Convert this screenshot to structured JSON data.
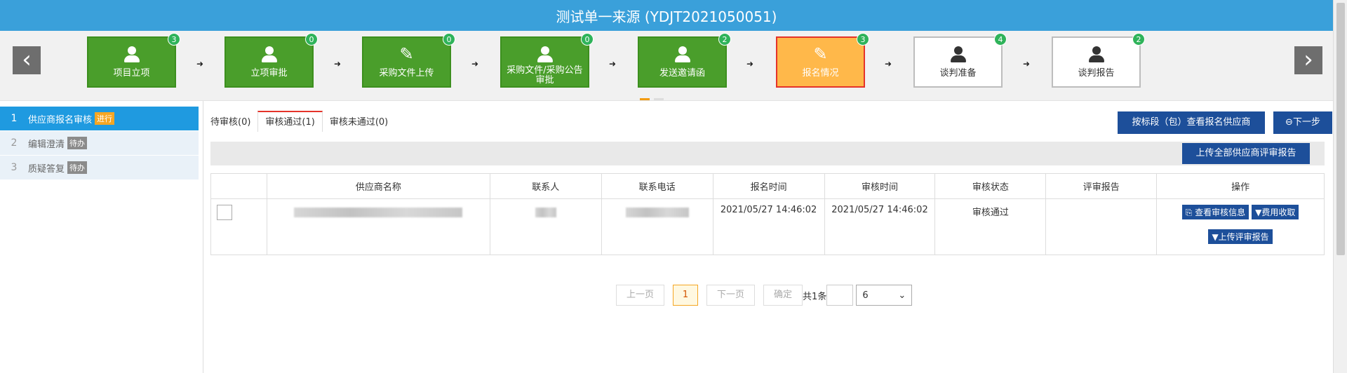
{
  "title": "测试单一来源 (YDJT2021050051)",
  "steps": [
    {
      "label": "项目立项",
      "count": "3",
      "icon": "person-icon",
      "state": "done"
    },
    {
      "label": "立项审批",
      "count": "0",
      "icon": "person-icon",
      "state": "done"
    },
    {
      "label": "采购文件上传",
      "count": "0",
      "icon": "pencil-icon",
      "state": "done"
    },
    {
      "label": "采购文件/采购公告审批",
      "count": "0",
      "icon": "person-icon",
      "state": "done"
    },
    {
      "label": "发送邀请函",
      "count": "2",
      "icon": "person-icon",
      "state": "done"
    },
    {
      "label": "报名情况",
      "count": "3",
      "icon": "pencil-icon",
      "state": "active"
    },
    {
      "label": "谈判准备",
      "count": "4",
      "icon": "person-icon",
      "state": "pending"
    },
    {
      "label": "谈判报告",
      "count": "2",
      "icon": "person-icon",
      "state": "pending"
    }
  ],
  "nav": {
    "prev": "‹",
    "next": "›",
    "arrow": "➜"
  },
  "sidebar": [
    {
      "num": "1",
      "label": "供应商报名审核",
      "tag": "进行"
    },
    {
      "num": "2",
      "label": "编辑澄清",
      "tag": "待办"
    },
    {
      "num": "3",
      "label": "质疑答复",
      "tag": "待办"
    }
  ],
  "tabs": [
    "待审核(0)",
    "审核通过(1)",
    "审核未通过(0)"
  ],
  "buttons": {
    "view_by_section": "按标段（包）查看报名供应商",
    "next_step": "⊖下一步",
    "upload_all": "上传全部供应商评审报告"
  },
  "table": {
    "headers": [
      "",
      "供应商名称",
      "联系人",
      "联系电话",
      "报名时间",
      "审核时间",
      "审核状态",
      "评审报告",
      "操作"
    ],
    "rows": [
      {
        "signup_time": "2021/05/27 14:46:02",
        "audit_time": "2021/05/27 14:46:02",
        "status": "审核通过"
      }
    ],
    "actions": {
      "view": "查看审核信息",
      "fee": "费用收取",
      "upload": "上传评审报告"
    }
  },
  "pager": {
    "prev": "上一页",
    "current": "1",
    "next": "下一页",
    "confirm": "确定",
    "total": "共1条",
    "page_size": "6"
  },
  "colors": {
    "header": "#3aa0da",
    "done": "#4a9e2b",
    "active": "#ffb84a",
    "primary": "#1d4f9a"
  }
}
